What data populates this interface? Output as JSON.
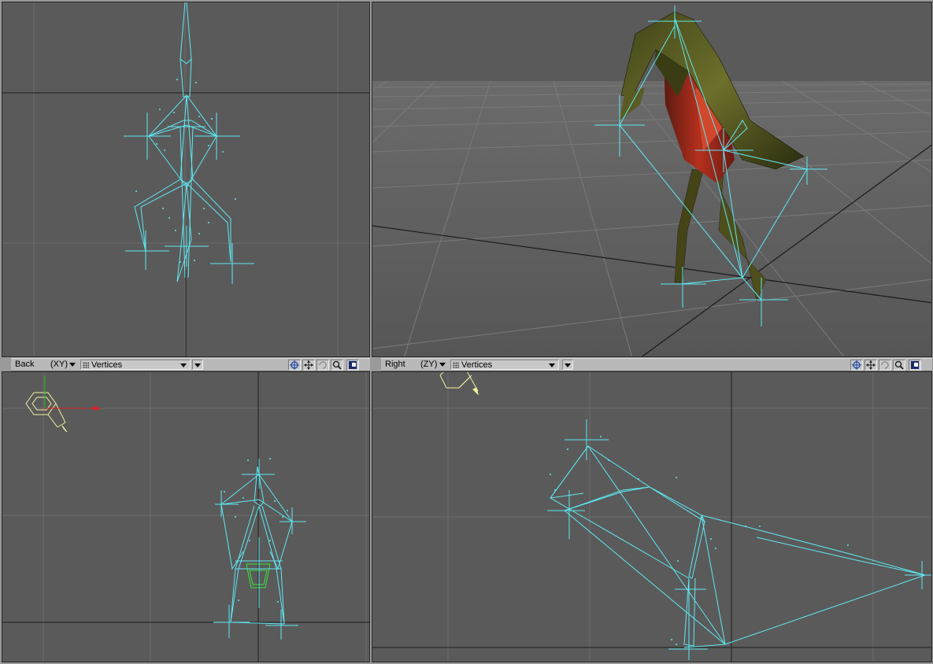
{
  "viewports": {
    "top_left": {
      "name": "",
      "content": "Skeleton front view (wireframe)"
    },
    "top_right": {
      "name": "",
      "content": "Perspective shaded model"
    },
    "bottom_left": {
      "name": "Back",
      "axis": "(XY)",
      "mode": "Vertices"
    },
    "bottom_right": {
      "name": "Right",
      "axis": "(ZY)",
      "mode": "Vertices"
    }
  },
  "icons": {
    "move": "move-view-icon",
    "rotate": "rotate-view-icon",
    "zoom": "zoom-view-icon",
    "maximize": "maximize-view-icon",
    "center": "center-view-icon"
  },
  "colors": {
    "viewport_bg": "#5a5a5a",
    "grid": "#6a6a6a",
    "axis_line": "#1e1e1e",
    "skeleton": "#5ee8f2",
    "camera": "#f2f0a0",
    "selected": "#37e637",
    "x_axis": "#e02020",
    "y_axis": "#20c020"
  }
}
